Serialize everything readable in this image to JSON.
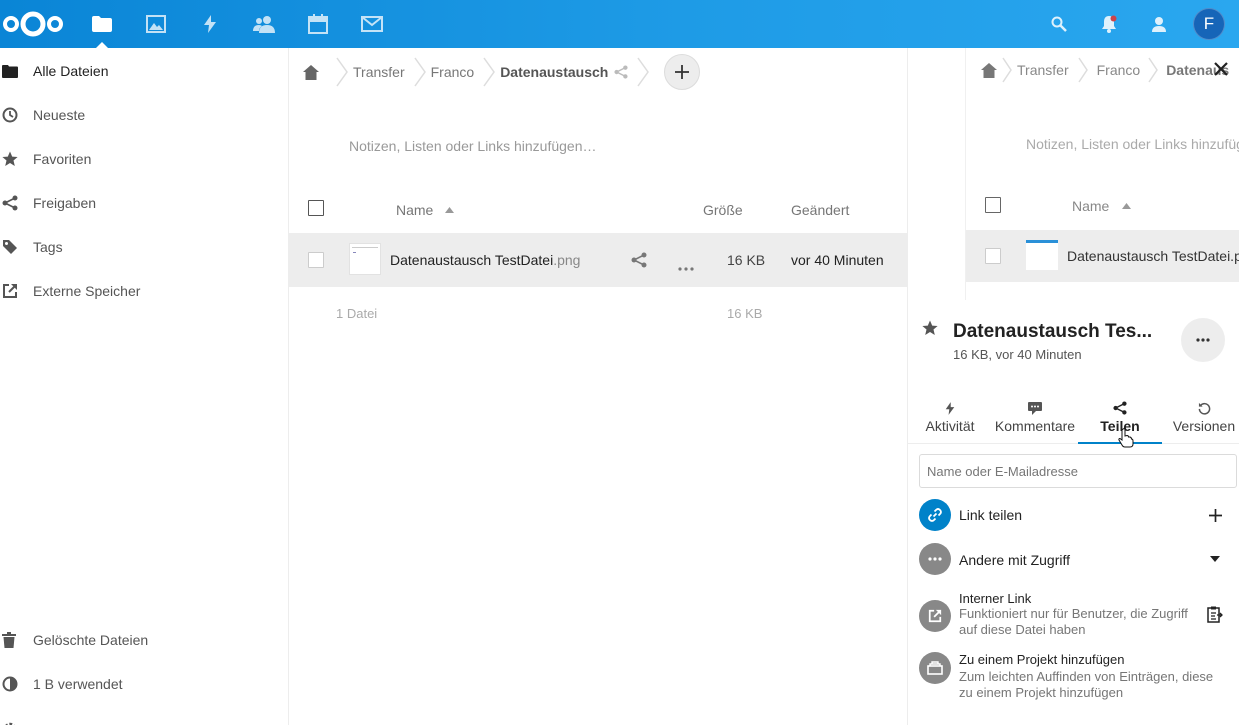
{
  "header": {
    "apps": [
      {
        "name": "files-icon",
        "active": true
      },
      {
        "name": "photos-icon",
        "active": false
      },
      {
        "name": "activity-icon",
        "active": false
      },
      {
        "name": "contacts-icon",
        "active": false
      },
      {
        "name": "calendar-icon",
        "active": false
      },
      {
        "name": "mail-icon",
        "active": false
      }
    ],
    "avatar_initial": "F",
    "accent": "#0082c9"
  },
  "nav": {
    "items": [
      {
        "label": "Alle Dateien",
        "icon": "folder-icon"
      },
      {
        "label": "Neueste",
        "icon": "clock-icon"
      },
      {
        "label": "Favoriten",
        "icon": "star-icon"
      },
      {
        "label": "Freigaben",
        "icon": "share-icon"
      },
      {
        "label": "Tags",
        "icon": "tag-icon"
      },
      {
        "label": "Externe Speicher",
        "icon": "external-icon"
      }
    ],
    "bottom": [
      {
        "label": "Gelöschte Dateien",
        "icon": "trash-icon"
      },
      {
        "label": "1 B verwendet",
        "icon": "quota-icon"
      }
    ]
  },
  "breadcrumb": {
    "items": [
      "Transfer",
      "Franco",
      "Datenaustausch"
    ]
  },
  "main": {
    "notes_placeholder": "Notizen, Listen oder Links hinzufügen…",
    "columns": {
      "name": "Name",
      "size": "Größe",
      "modified": "Geändert"
    },
    "files": [
      {
        "basename": "Datenaustausch TestDatei",
        "ext": ".png",
        "size": "16 KB",
        "modified": "vor 40 Minuten"
      }
    ],
    "summary": {
      "count": "1 Datei",
      "size": "16 KB"
    }
  },
  "sidebar": {
    "preview": {
      "crumbs": [
        "Transfer",
        "Franco",
        "Datenaus"
      ],
      "notes": "Notizen, Listen oder Links hinzufüg",
      "col_name": "Name",
      "file": "Datenaustausch TestDatei.pn"
    },
    "title": "Datenaustausch Tes...",
    "subtitle": "16 KB, vor 40 Minuten",
    "tabs": [
      {
        "label": "Aktivität",
        "icon": "activity-icon"
      },
      {
        "label": "Kommentare",
        "icon": "comment-icon"
      },
      {
        "label": "Teilen",
        "icon": "share-icon",
        "active": true
      },
      {
        "label": "Versionen",
        "icon": "history-icon"
      }
    ],
    "share_placeholder": "Name oder E-Mailadresse",
    "link_share": "Link teilen",
    "others_access": "Andere mit Zugriff",
    "internal_link": {
      "title": "Interner Link",
      "desc": "Funktioniert nur für Benutzer, die Zugriff auf diese Datei haben"
    },
    "project": {
      "title": "Zu einem Projekt hinzufügen",
      "desc": "Zum leichten Auffinden von Einträgen, diese zu einem Projekt hinzufügen"
    }
  }
}
